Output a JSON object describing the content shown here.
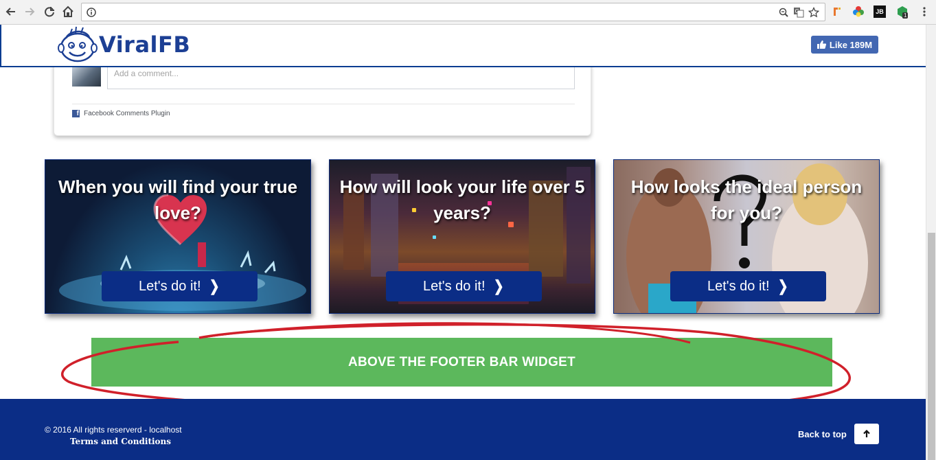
{
  "browser": {
    "url": "",
    "icons": [
      "back-icon",
      "forward-icon",
      "reload-icon",
      "home-icon",
      "info-icon",
      "zoom-icon",
      "translate-icon",
      "bookmark-star-icon"
    ],
    "extensions": [
      "extension-1-icon",
      "extension-2-icon",
      "jb-extension-icon",
      "extension-4-icon",
      "menu-icon"
    ],
    "jb_label": "JB",
    "ext_badge": "1"
  },
  "header": {
    "logo_text": "ViralFB",
    "like_label": "Like 189M"
  },
  "comments": {
    "placeholder": "Add a comment...",
    "plugin_label": "Facebook Comments Plugin",
    "plugin_icon": "f"
  },
  "cards": [
    {
      "title": "When you will find your true love?",
      "button": "Let's do it!",
      "chevron": "❯"
    },
    {
      "title": "How will look your life over 5 years?",
      "button": "Let's do it!",
      "chevron": "❯"
    },
    {
      "title": "How looks the ideal person for you?",
      "button": "Let's do it!",
      "chevron": "❯"
    }
  ],
  "widget": {
    "label": "ABOVE THE FOOTER BAR WIDGET",
    "annotation_color": "#d0202a"
  },
  "footer": {
    "copyright": "© 2016 All rights reserverd - localhost",
    "terms": "Terms and Conditions",
    "back_to_top": "Back to top",
    "arrow": "↑"
  },
  "colors": {
    "brand_blue": "#0b2d86",
    "widget_green": "#5cb85c",
    "facebook_blue": "#4267b2"
  }
}
